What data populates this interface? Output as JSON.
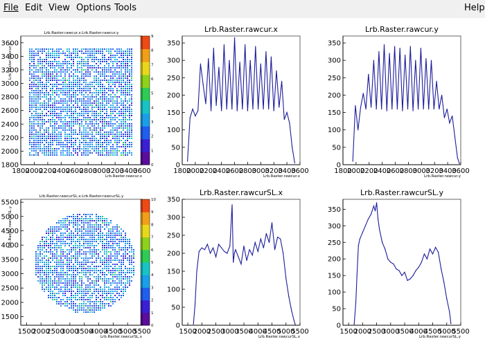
{
  "menubar": {
    "items": [
      {
        "label": "File"
      },
      {
        "label": "Edit"
      },
      {
        "label": "View"
      },
      {
        "label": "Options"
      },
      {
        "label": "Tools"
      }
    ],
    "help": "Help"
  },
  "colors": {
    "trace": "#1a1a9a",
    "palette": [
      "#5b0d9c",
      "#3a1fd6",
      "#1f5ff0",
      "#1aa0e8",
      "#16c4c4",
      "#2ecc55",
      "#8ed21a",
      "#e8d81a",
      "#f0a018",
      "#ee4a16"
    ]
  },
  "chart_data": [
    {
      "type": "heatmap",
      "title": "Lrb.Raster.rawcur.x:Lrb.Raster.rawcur.y",
      "xlabel": "Lrb.Raster.rawcur.x",
      "ylabel": "Lrb.Raster.rawcur.y",
      "xticks": [
        "1800",
        "2000",
        "2200",
        "2400",
        "2600",
        "2800",
        "3000",
        "3200",
        "3400",
        "3600"
      ],
      "yticks": [
        "1800",
        "2000",
        "2200",
        "2400",
        "2600",
        "2800",
        "3000",
        "3200",
        "3400",
        "3600"
      ],
      "zticks": [
        "0",
        "1",
        "2",
        "3",
        "4",
        "5",
        "6",
        "7",
        "8",
        "9"
      ],
      "xlim": [
        1800,
        3600
      ],
      "ylim": [
        1800,
        3700
      ],
      "zlim": [
        0,
        9
      ],
      "region": {
        "shape": "rect",
        "xmin": 1900,
        "xmax": 3450,
        "ymin": 1950,
        "ymax": 3520
      }
    },
    {
      "type": "line",
      "title": "Lrb.Raster.rawcur.x",
      "xlabel": "Lrb.Raster.rawcur.x",
      "xticks": [
        "1800",
        "2000",
        "2200",
        "2400",
        "2600",
        "2800",
        "3000",
        "3200",
        "3400",
        "3600"
      ],
      "yticks": [
        "0",
        "50",
        "100",
        "150",
        "200",
        "250",
        "300",
        "350"
      ],
      "xlim": [
        1800,
        3600
      ],
      "ylim": [
        0,
        370
      ],
      "x": [
        1880,
        1920,
        1960,
        2000,
        2040,
        2080,
        2120,
        2160,
        2200,
        2240,
        2280,
        2320,
        2360,
        2400,
        2440,
        2480,
        2520,
        2560,
        2600,
        2640,
        2680,
        2720,
        2760,
        2800,
        2840,
        2880,
        2920,
        2960,
        3000,
        3040,
        3080,
        3120,
        3160,
        3200,
        3240,
        3280,
        3320,
        3360,
        3400,
        3440,
        3480,
        3520
      ],
      "y": [
        10,
        135,
        160,
        140,
        155,
        290,
        230,
        175,
        305,
        155,
        335,
        170,
        280,
        155,
        345,
        160,
        300,
        160,
        365,
        155,
        295,
        160,
        345,
        155,
        300,
        160,
        340,
        160,
        290,
        160,
        325,
        160,
        310,
        155,
        270,
        165,
        240,
        130,
        150,
        120,
        50,
        5
      ]
    },
    {
      "type": "line",
      "title": "Lrb.Raster.rawcur.y",
      "xlabel": "Lrb.Raster.rawcur.y",
      "xticks": [
        "1800",
        "2000",
        "2200",
        "2400",
        "2600",
        "2800",
        "3000",
        "3200",
        "3400",
        "3600"
      ],
      "yticks": [
        "0",
        "50",
        "100",
        "150",
        "200",
        "250",
        "300",
        "350"
      ],
      "xlim": [
        1800,
        3600
      ],
      "ylim": [
        0,
        370
      ],
      "x": [
        1950,
        1990,
        2030,
        2070,
        2110,
        2150,
        2190,
        2230,
        2270,
        2310,
        2350,
        2390,
        2430,
        2470,
        2510,
        2550,
        2590,
        2630,
        2670,
        2710,
        2750,
        2790,
        2830,
        2870,
        2910,
        2950,
        2990,
        3030,
        3070,
        3110,
        3150,
        3190,
        3230,
        3270,
        3310,
        3350,
        3390,
        3430,
        3470,
        3510,
        3550,
        3580
      ],
      "y": [
        10,
        170,
        100,
        165,
        205,
        160,
        260,
        165,
        300,
        160,
        325,
        160,
        345,
        155,
        320,
        160,
        340,
        160,
        335,
        155,
        315,
        160,
        340,
        155,
        300,
        160,
        335,
        160,
        305,
        160,
        300,
        160,
        240,
        160,
        200,
        135,
        160,
        120,
        140,
        80,
        20,
        3
      ]
    },
    {
      "type": "heatmap",
      "title": "Lrb.Raster.rawcurSL.x:Lrb.Raster.rawcurSL.y",
      "xlabel": "Lrb.Raster.rawcurSL.x",
      "ylabel": "Lrb.Raster.rawcurSL.y",
      "xticks": [
        "1500",
        "2000",
        "2500",
        "3000",
        "3500",
        "4000",
        "4500",
        "5000",
        "5500"
      ],
      "yticks": [
        "1500",
        "2000",
        "2500",
        "3000",
        "3500",
        "4000",
        "4500",
        "5000",
        "5500"
      ],
      "zticks": [
        "0",
        "1",
        "2",
        "3",
        "4",
        "5",
        "6",
        "7",
        "8",
        "9",
        "10"
      ],
      "xlim": [
        1300,
        5500
      ],
      "ylim": [
        1200,
        5600
      ],
      "zlim": [
        0,
        10
      ],
      "region": {
        "shape": "circle",
        "cx": 3500,
        "cy": 3400,
        "r": 1750
      }
    },
    {
      "type": "line",
      "title": "Lrb.Raster.rawcurSL.x",
      "xlabel": "Lrb.Raster.rawcurSL.x",
      "xticks": [
        "1500",
        "2000",
        "2500",
        "3000",
        "3500",
        "4000",
        "4500",
        "5000",
        "5500"
      ],
      "yticks": [
        "0",
        "50",
        "100",
        "150",
        "200",
        "250",
        "300",
        "350"
      ],
      "xlim": [
        1300,
        5500
      ],
      "ylim": [
        0,
        350
      ],
      "x": [
        1700,
        1760,
        1820,
        1900,
        2000,
        2100,
        2200,
        2300,
        2400,
        2500,
        2600,
        2700,
        2800,
        2900,
        3000,
        3080,
        3120,
        3160,
        3200,
        3300,
        3400,
        3500,
        3600,
        3700,
        3800,
        3900,
        4000,
        4100,
        4200,
        4300,
        4400,
        4500,
        4600,
        4700,
        4800,
        4900,
        5000,
        5100,
        5200,
        5280,
        5330
      ],
      "y": [
        3,
        60,
        150,
        205,
        215,
        210,
        225,
        200,
        215,
        190,
        225,
        215,
        205,
        200,
        220,
        335,
        175,
        200,
        210,
        190,
        170,
        220,
        180,
        210,
        195,
        230,
        205,
        240,
        215,
        255,
        230,
        285,
        210,
        245,
        240,
        200,
        130,
        80,
        40,
        15,
        2
      ]
    },
    {
      "type": "line",
      "title": "Lrb.Raster.rawcurSL.y",
      "xlabel": "Lrb.Raster.rawcurSL.y",
      "xticks": [
        "1500",
        "2000",
        "2500",
        "3000",
        "3500",
        "4000",
        "4500",
        "5000",
        "5500"
      ],
      "yticks": [
        "0",
        "50",
        "100",
        "150",
        "200",
        "250",
        "300",
        "350"
      ],
      "xlim": [
        1300,
        5500
      ],
      "ylim": [
        0,
        380
      ],
      "x": [
        1700,
        1760,
        1800,
        1850,
        1900,
        2000,
        2100,
        2200,
        2300,
        2400,
        2450,
        2500,
        2550,
        2600,
        2700,
        2800,
        2900,
        3000,
        3100,
        3200,
        3300,
        3400,
        3500,
        3600,
        3700,
        3800,
        3900,
        4000,
        4100,
        4200,
        4300,
        4400,
        4500,
        4600,
        4700,
        4800,
        4900,
        5000,
        5100,
        5150
      ],
      "y": [
        3,
        70,
        150,
        240,
        260,
        280,
        300,
        320,
        335,
        360,
        345,
        370,
        320,
        290,
        250,
        230,
        200,
        190,
        185,
        170,
        165,
        150,
        160,
        135,
        140,
        150,
        165,
        175,
        190,
        215,
        200,
        230,
        215,
        235,
        220,
        170,
        130,
        80,
        40,
        5
      ]
    }
  ]
}
